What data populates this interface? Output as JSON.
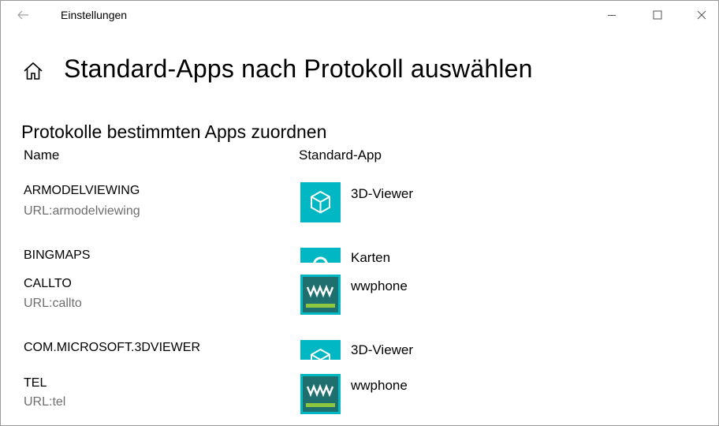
{
  "window": {
    "title": "Einstellungen"
  },
  "header": {
    "title": "Standard-Apps nach Protokoll auswählen"
  },
  "section": {
    "title": "Protokolle bestimmten Apps zuordnen",
    "col_name": "Name",
    "col_app": "Standard-App"
  },
  "rows": [
    {
      "name": "ARMODELVIEWING",
      "sub": "URL:armodelviewing",
      "app": "3D-Viewer",
      "icon": "3d-viewer-icon",
      "color": "#00b7c3"
    },
    {
      "name": "BINGMAPS",
      "sub": "",
      "app": "Karten",
      "icon": "maps-icon",
      "color": "#00b7c3"
    },
    {
      "name": "CALLTO",
      "sub": "URL:callto",
      "app": "wwphone",
      "icon": "wwphone-icon",
      "color": "#00b7c3"
    },
    {
      "name": "COM.MICROSOFT.3DVIEWER",
      "sub": "",
      "app": "3D-Viewer",
      "icon": "3d-viewer-icon",
      "color": "#00b7c3"
    },
    {
      "name": "TEL",
      "sub": "URL:tel",
      "app": "wwphone",
      "icon": "wwphone-icon",
      "color": "#00b7c3"
    }
  ],
  "colors": {
    "tile": "#00b7c3",
    "wwphone_bar": "#8dc63f",
    "wwphone_bg": "#1f6f6f"
  }
}
